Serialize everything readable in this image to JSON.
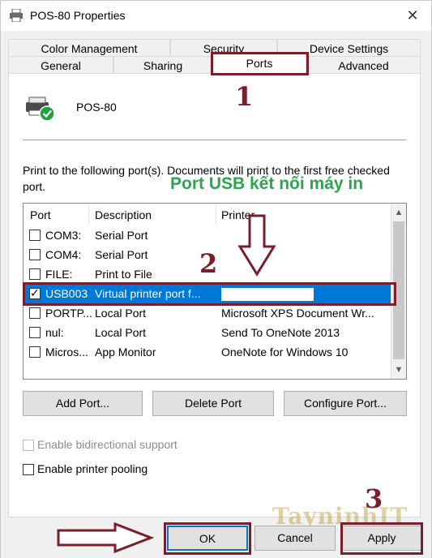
{
  "window": {
    "title": "POS-80 Properties",
    "close_glyph": "✕"
  },
  "tabs": {
    "row1": [
      "Color Management",
      "Security",
      "Device Settings"
    ],
    "row2": [
      "General",
      "Sharing",
      "Ports",
      "Advanced"
    ],
    "active": "Ports"
  },
  "printer": {
    "name": "POS-80"
  },
  "description": "Print to the following port(s). Documents will print to the first free checked port.",
  "annotations": {
    "num1": "1",
    "num2": "2",
    "num3": "3",
    "green_note": "Port USB kết nối máy in",
    "watermark": "TayninhIT",
    "color": "#7b1e2b",
    "note_color": "#2ea44f"
  },
  "ports_list": {
    "columns": [
      "Port",
      "Description",
      "Printer"
    ],
    "rows": [
      {
        "port": "COM3:",
        "description": "Serial Port",
        "printer": "",
        "checked": false,
        "selected": false
      },
      {
        "port": "COM4:",
        "description": "Serial Port",
        "printer": "",
        "checked": false,
        "selected": false
      },
      {
        "port": "FILE:",
        "description": "Print to File",
        "printer": "",
        "checked": false,
        "selected": false
      },
      {
        "port": "USB003",
        "description": "Virtual printer port f...",
        "printer": "",
        "checked": true,
        "selected": true
      },
      {
        "port": "PORTP...",
        "description": "Local Port",
        "printer": "Microsoft XPS Document Wr...",
        "checked": false,
        "selected": false
      },
      {
        "port": "nul:",
        "description": "Local Port",
        "printer": "Send To OneNote 2013",
        "checked": false,
        "selected": false
      },
      {
        "port": "Micros...",
        "description": "App Monitor",
        "printer": "OneNote for Windows 10",
        "checked": false,
        "selected": false
      }
    ],
    "selected_color": "#0078d7"
  },
  "buttons": {
    "add_port": "Add Port...",
    "delete_port": "Delete Port",
    "configure_port": "Configure Port...",
    "ok": "OK",
    "cancel": "Cancel",
    "apply": "Apply"
  },
  "options": {
    "bidirectional": {
      "label": "Enable bidirectional support",
      "checked": false,
      "enabled": false
    },
    "pooling": {
      "label": "Enable printer pooling",
      "checked": false,
      "enabled": true
    }
  }
}
